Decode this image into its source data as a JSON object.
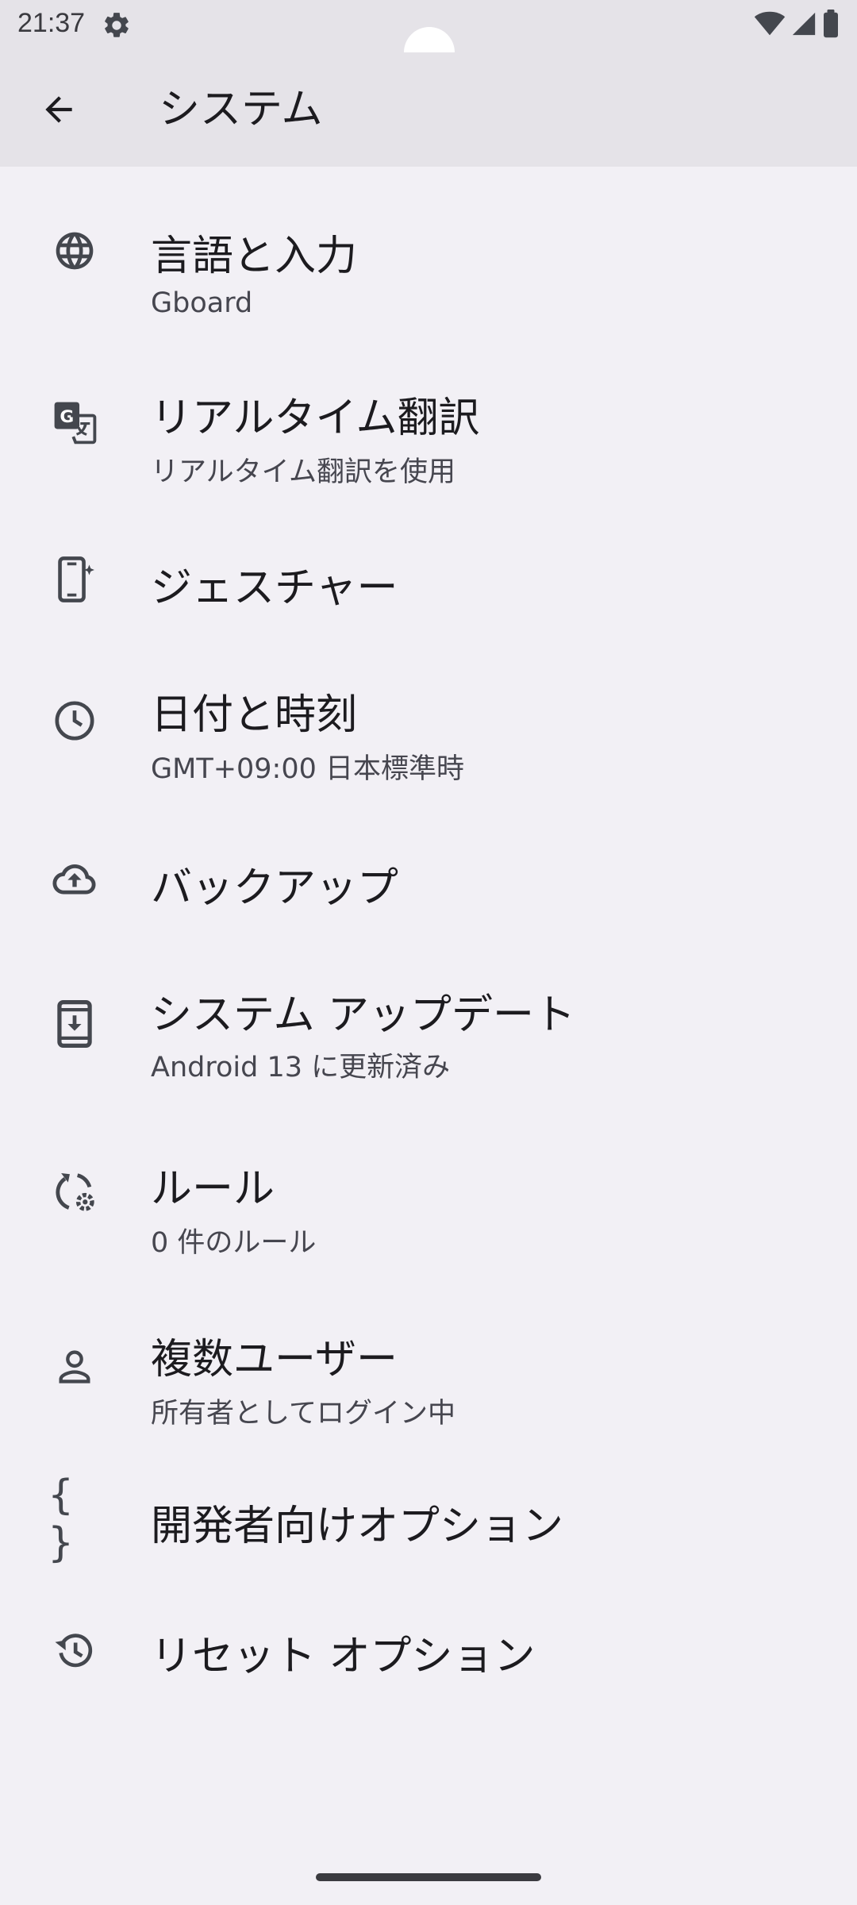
{
  "status_bar": {
    "time": "21:37",
    "icons": [
      "settings-gear-icon",
      "wifi-icon",
      "signal-icon",
      "battery-icon"
    ]
  },
  "app_bar": {
    "title": "システム",
    "back_icon": "arrow-back-icon"
  },
  "items": [
    {
      "icon": "globe-icon",
      "title": "言語と入力",
      "subtitle": "Gboard"
    },
    {
      "icon": "translate-icon",
      "title": "リアルタイム翻訳",
      "subtitle": "リアルタイム翻訳を使用"
    },
    {
      "icon": "gesture-phone-icon",
      "title": "ジェスチャー",
      "subtitle": ""
    },
    {
      "icon": "clock-icon",
      "title": "日付と時刻",
      "subtitle": "GMT+09:00 日本標準時"
    },
    {
      "icon": "cloud-upload-icon",
      "title": "バックアップ",
      "subtitle": ""
    },
    {
      "icon": "system-update-icon",
      "title": "システム アップデート",
      "subtitle": "Android 13 に更新済み"
    },
    {
      "icon": "rules-icon",
      "title": "ルール",
      "subtitle": "0 件のルール"
    },
    {
      "icon": "person-icon",
      "title": "複数ユーザー",
      "subtitle": "所有者としてログイン中"
    },
    {
      "icon": "braces-icon",
      "title": "開発者向けオプション",
      "subtitle": "",
      "glyph": "{ }"
    },
    {
      "icon": "history-icon",
      "title": "リセット オプション",
      "subtitle": ""
    }
  ],
  "colors": {
    "background": "#f2f0f5",
    "app_bar": "#e5e3e8",
    "icon": "#44474e",
    "title": "#1c1b1f",
    "subtitle": "#46464f"
  }
}
